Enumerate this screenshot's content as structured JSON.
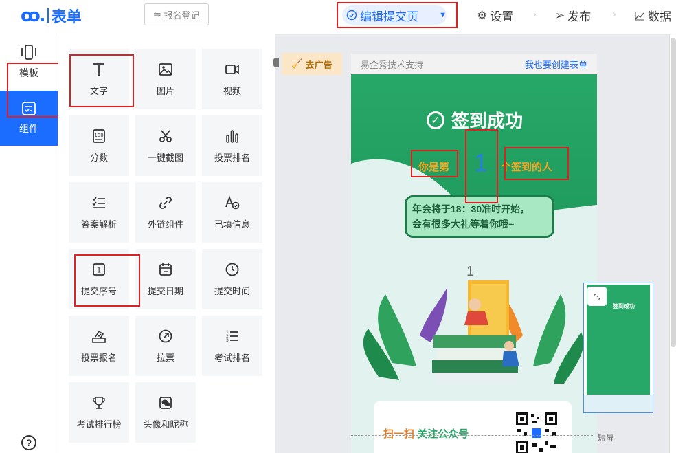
{
  "app": {
    "logo_mark": "ꝏ.",
    "logo_text": "表单"
  },
  "topbar": {
    "register_button": "报名登记",
    "edit_submit_page": "编辑提交页",
    "settings": "设置",
    "publish": "发布",
    "data": "数据"
  },
  "leftnav": {
    "items": [
      {
        "label": "模板",
        "icon": "phone-icon"
      },
      {
        "label": "组件",
        "icon": "form-icon",
        "active": true
      }
    ],
    "help_glyph": "?"
  },
  "components": [
    {
      "label": "文字",
      "icon": "text-icon"
    },
    {
      "label": "图片",
      "icon": "image-icon"
    },
    {
      "label": "视频",
      "icon": "video-icon"
    },
    {
      "label": "分数",
      "icon": "score-icon"
    },
    {
      "label": "一键截图",
      "icon": "scissors-icon"
    },
    {
      "label": "投票排名",
      "icon": "bar-chart-icon"
    },
    {
      "label": "答案解析",
      "icon": "checklist-icon"
    },
    {
      "label": "外链组件",
      "icon": "link-icon"
    },
    {
      "label": "已填信息",
      "icon": "font-check-icon"
    },
    {
      "label": "提交序号",
      "icon": "number-icon"
    },
    {
      "label": "提交日期",
      "icon": "calendar-icon"
    },
    {
      "label": "提交时间",
      "icon": "clock-icon"
    },
    {
      "label": "投票报名",
      "icon": "vote-box-icon"
    },
    {
      "label": "拉票",
      "icon": "share-icon"
    },
    {
      "label": "考试排名",
      "icon": "ordered-list-icon"
    },
    {
      "label": "考试排行榜",
      "icon": "trophy-icon"
    },
    {
      "label": "头像和昵称",
      "icon": "wechat-icon"
    }
  ],
  "canvas": {
    "ad_tag": "去广告",
    "phone_header_left": "易企秀技术支持",
    "phone_header_right": "我也要创建表单",
    "success_title": "签到成功",
    "rank_prefix": "你是第",
    "rank_number": "1",
    "rank_suffix": "个签到的人",
    "notice_line1": "年会将于18：30准时开始，",
    "notice_line2": "会有很多大礼等着你哦~",
    "illustration_number": "1",
    "qr_text_prefix": "扫一扫",
    "qr_text_main": "关注公众号",
    "short_screen_label": "短屏"
  },
  "thumbnail": {
    "title": "签到成功"
  },
  "colors": {
    "brand": "#1a6dff",
    "highlight": "#e02020",
    "hero_green": "#27a768",
    "rank_orange": "#f5a623"
  }
}
